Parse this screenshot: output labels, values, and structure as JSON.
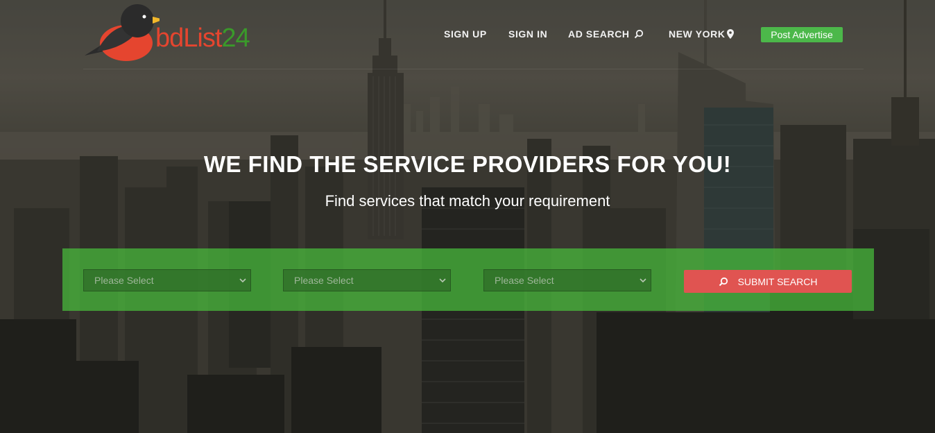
{
  "brand": {
    "name_part1": "bdList",
    "name_part2": "24",
    "colors": {
      "bird_body": "#e5452f",
      "text_accent": "#3a9a2a",
      "bird_head": "#2b2b2b",
      "beak": "#f2b82a"
    }
  },
  "nav": {
    "items": [
      {
        "label": "SIGN UP",
        "icon": null
      },
      {
        "label": "SIGN IN",
        "icon": null
      },
      {
        "label": "AD SEARCH",
        "icon": "search-icon"
      },
      {
        "label": "NEW YORK",
        "icon": "map-pin-icon"
      }
    ],
    "post_button_label": "Post Advertise"
  },
  "hero": {
    "title": "WE FIND THE SERVICE PROVIDERS FOR YOU!",
    "subtitle": "Find services that match your requirement"
  },
  "search": {
    "selects": [
      {
        "selected": "Please Select"
      },
      {
        "selected": "Please Select"
      },
      {
        "selected": "Please Select"
      }
    ],
    "submit_label": "SUBMIT SEARCH"
  },
  "colors": {
    "post_button": "#4cb84a",
    "search_panel": "#48be3c",
    "submit_button": "#e05451"
  }
}
